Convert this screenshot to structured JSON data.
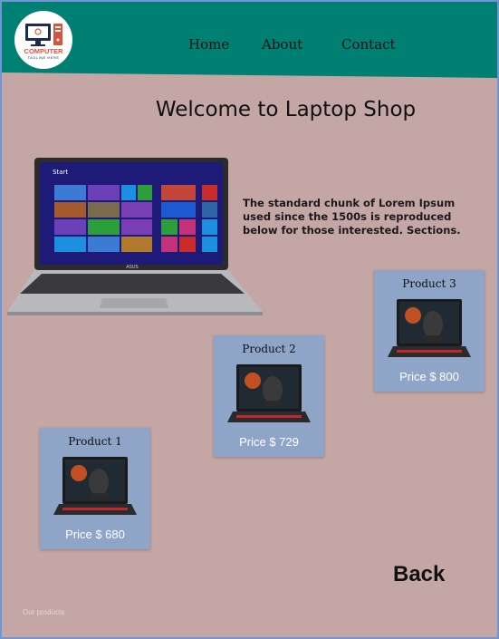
{
  "logo": {
    "brand": "COMPUTER",
    "tagline": "TAGLINE HERE"
  },
  "nav": {
    "home": "Home",
    "about": "About",
    "contact": "Contact"
  },
  "page_title": "Welcome to Laptop Shop",
  "hero": {
    "start_label": "Start",
    "brand": "ASUS"
  },
  "intro_text": "The standard chunk of Lorem Ipsum used since the 1500s is reproduced below for those interested. Sections.",
  "products": [
    {
      "name": "Product 1",
      "price": "Price $ 680"
    },
    {
      "name": "Product 2",
      "price": "Price $ 729"
    },
    {
      "name": "Product 3",
      "price": "Price $ 800"
    }
  ],
  "back_label": "Back",
  "footer_note": "Our products",
  "colors": {
    "header": "#007f73",
    "background": "#c4a7a5",
    "card": "#8ea5c8",
    "border": "#6f97d6"
  }
}
